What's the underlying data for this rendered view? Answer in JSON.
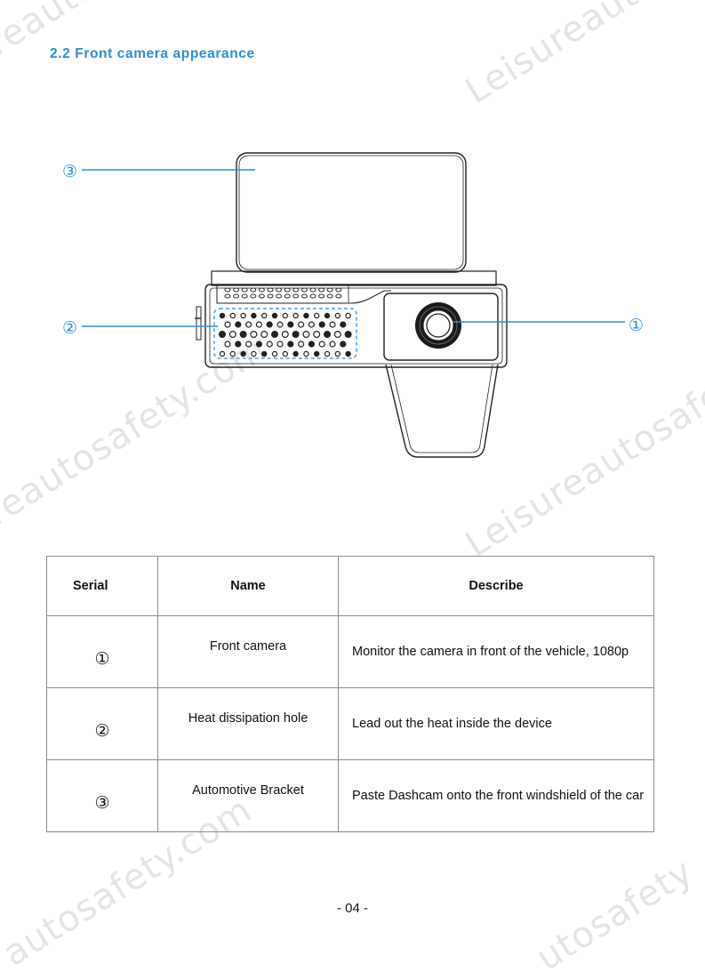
{
  "watermark": {
    "text_full": "Leisureautosafety.com",
    "fragments": [
      "ureautosafe",
      "Leisureautosafe",
      "sureautosafety.com",
      "Leisureautosafety",
      "autosafety.com",
      "utosafety"
    ]
  },
  "heading": "2.2  Front camera appearance",
  "diagram": {
    "callouts": [
      {
        "id": 3,
        "symbol": "③",
        "target": "Automotive Bracket"
      },
      {
        "id": 2,
        "symbol": "②",
        "target": "Heat dissipation hole"
      },
      {
        "id": 1,
        "symbol": "①",
        "target": "Front camera"
      }
    ],
    "accent_color": "#2f8fd6"
  },
  "table": {
    "headers": {
      "serial": "Serial",
      "name": "Name",
      "describe": "Describe"
    },
    "rows": [
      {
        "serial": "①",
        "name": "Front camera",
        "describe": "Monitor the camera in front of the vehicle,  1080p"
      },
      {
        "serial": "②",
        "name": "Heat dissipation hole",
        "describe": "Lead out the heat  inside the device"
      },
      {
        "serial": "③",
        "name": "Automotive  Bracket",
        "describe": "Paste  Dashcam onto the front windshield of the car"
      }
    ]
  },
  "page_number": "- 04 -"
}
